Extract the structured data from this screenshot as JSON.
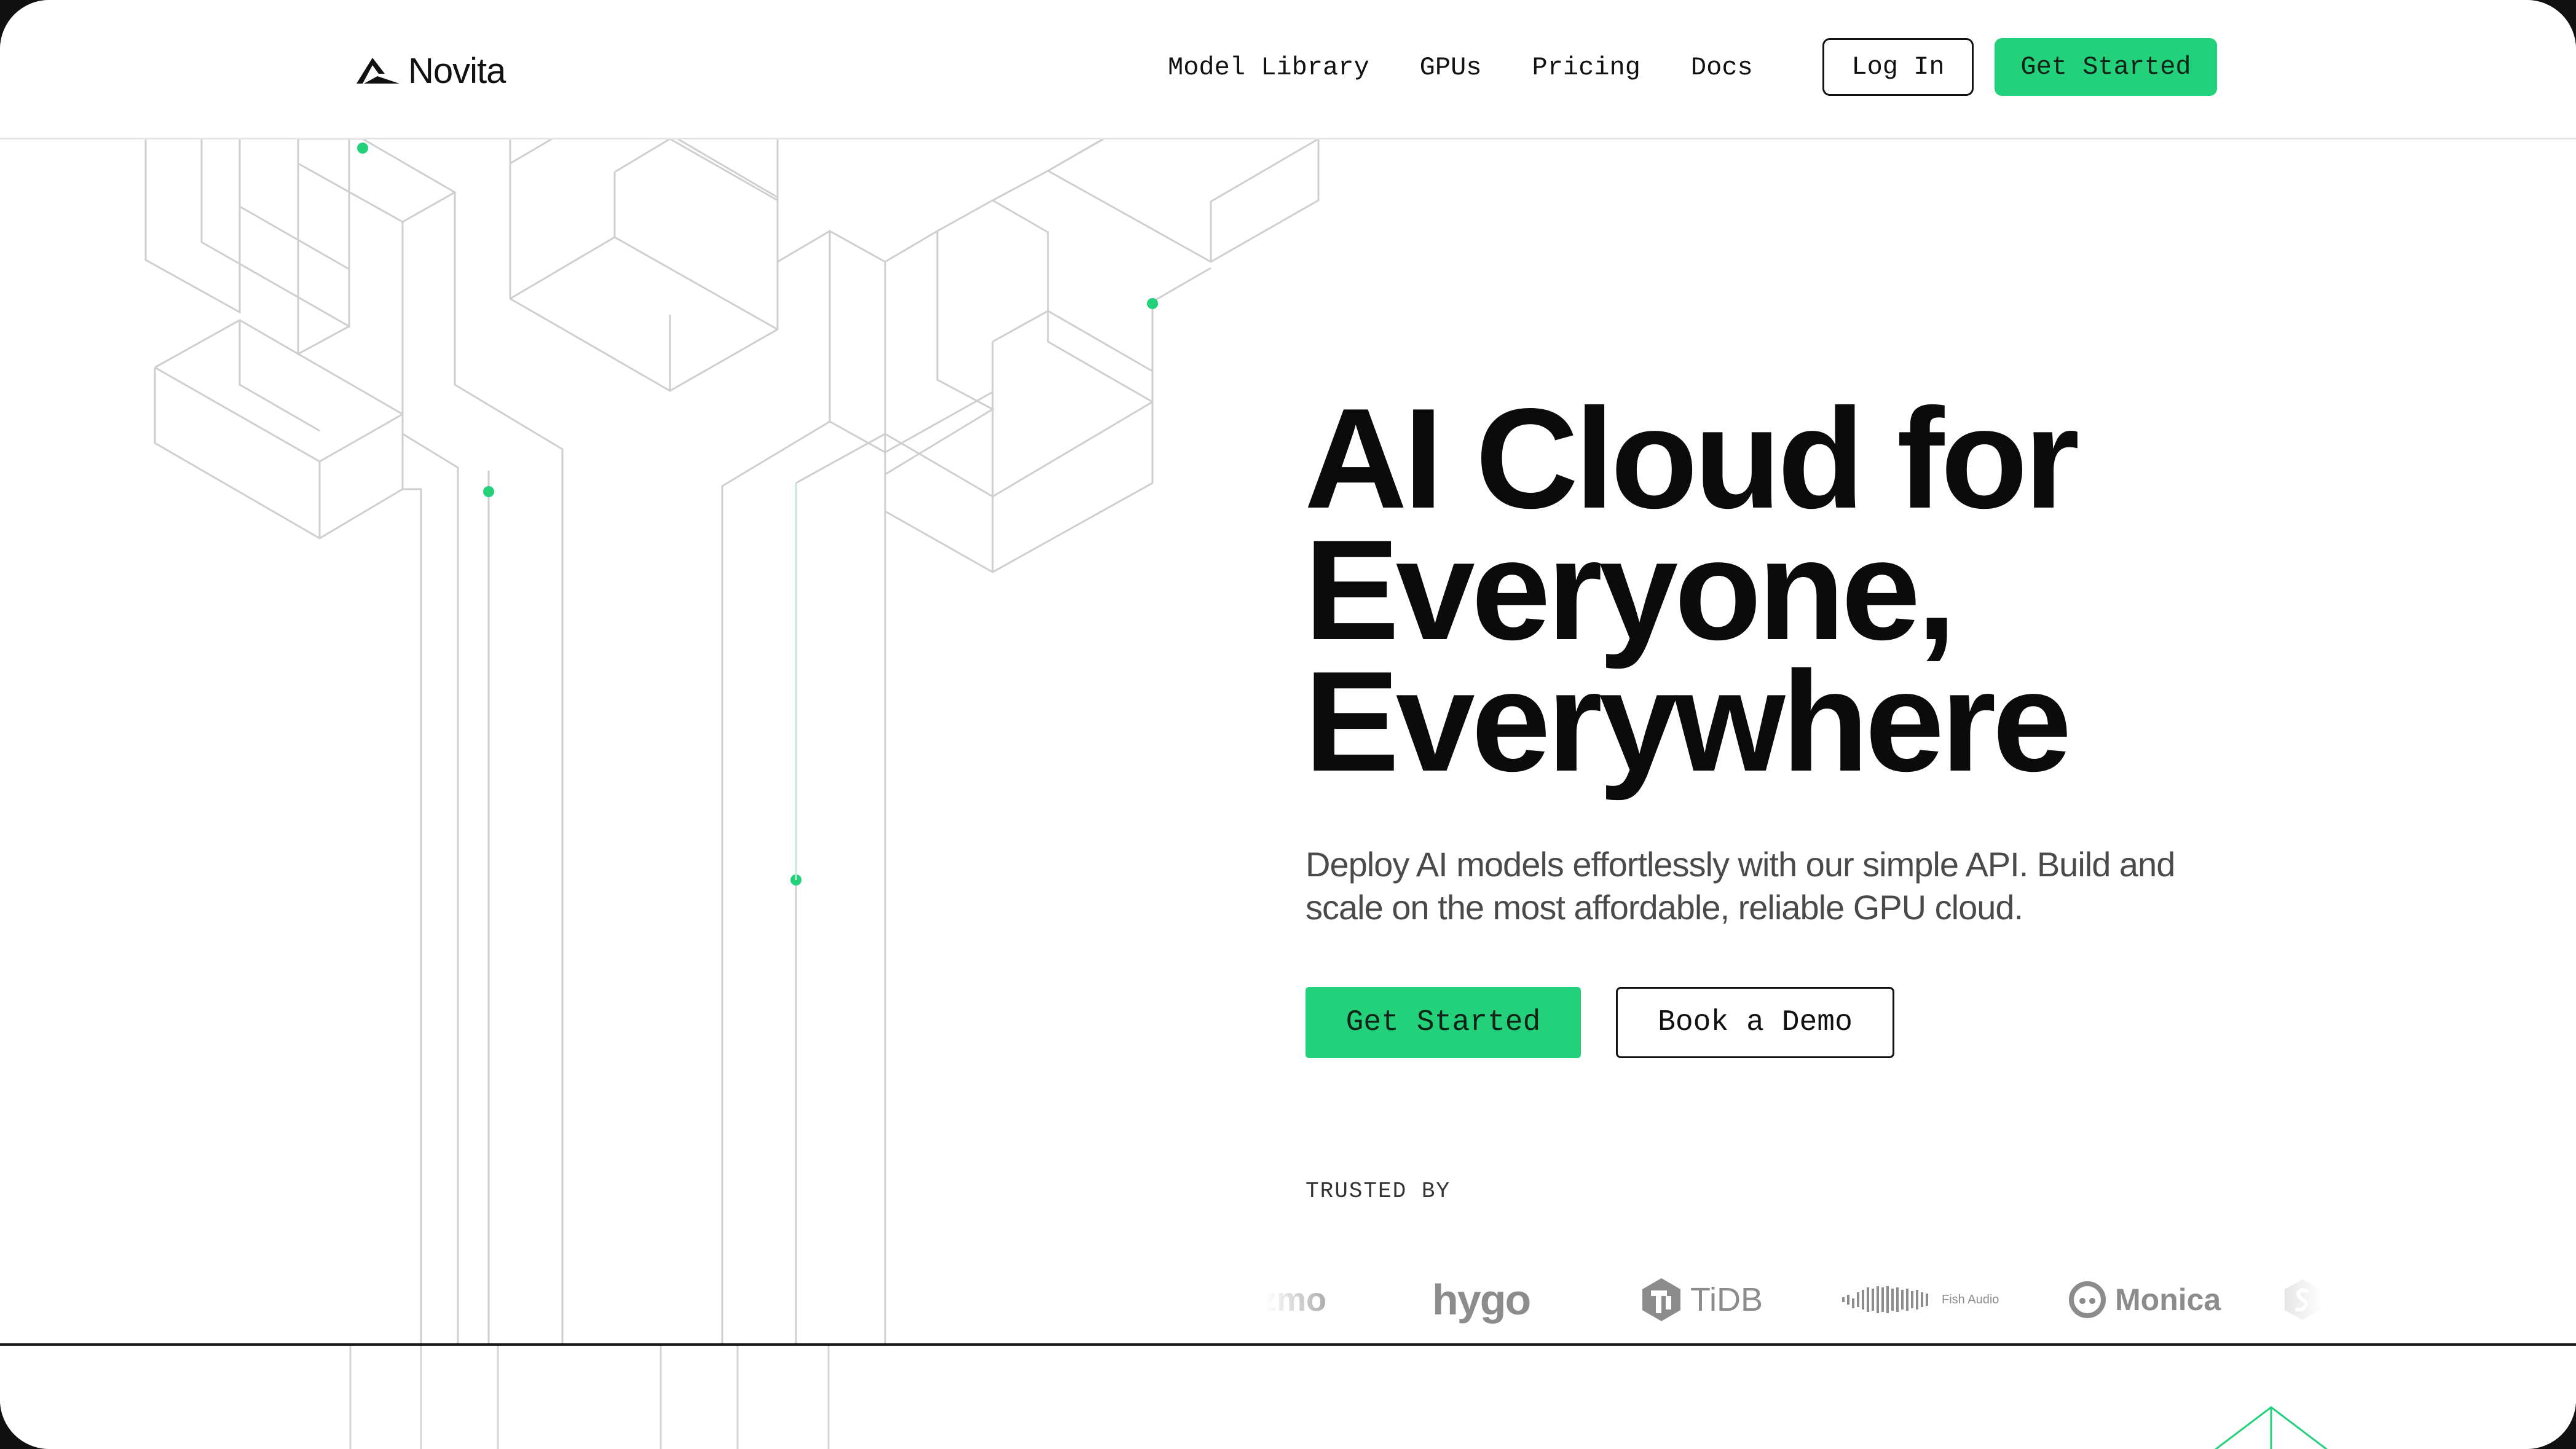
{
  "brand": {
    "name": "Novita",
    "accent_color": "#23d17a",
    "text_color": "#0b0b0b"
  },
  "nav": {
    "items": [
      "Model Library",
      "GPUs",
      "Pricing",
      "Docs"
    ],
    "login_label": "Log In",
    "get_started_label": "Get Started"
  },
  "hero": {
    "title_lines": [
      "AI Cloud for",
      "Everyone,",
      "Everywhere"
    ],
    "subtitle": "Deploy AI models effortlessly with our simple API. Build and scale on the most affordable, reliable GPU cloud.",
    "primary_cta": "Get Started",
    "secondary_cta": "Book a Demo"
  },
  "trusted": {
    "label": "TRUSTED BY",
    "logos": [
      {
        "name": "zmo",
        "icon": "zmo-logo"
      },
      {
        "name": "hygo",
        "icon": "hygo-logo"
      },
      {
        "name": "TiDB",
        "icon": "tidb-logo"
      },
      {
        "name": "Fish Audio",
        "icon": "fish-audio-logo"
      },
      {
        "name": "Monica",
        "icon": "monica-logo"
      },
      {
        "name": "",
        "icon": "partial-logo"
      }
    ]
  },
  "decoration": {
    "line_color": "#cfcfcf",
    "node_color": "#23d17a",
    "icons": [
      "isometric-line-art",
      "connection-node-dot"
    ]
  }
}
